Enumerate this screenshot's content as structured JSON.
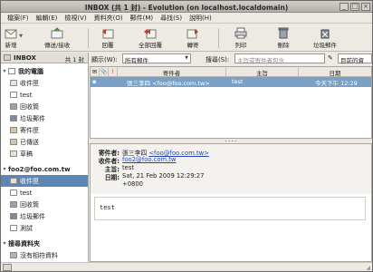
{
  "window": {
    "title": "INBOX (共 1 封) - Evolution (on localhost.localdomain)"
  },
  "menubar": [
    "檔案(F)",
    "編輯(E)",
    "檢視(V)",
    "資料夾(O)",
    "郵件(M)",
    "尋找(S)",
    "說明(H)"
  ],
  "toolbar": {
    "new": "新增",
    "send_receive": "傳送/接收",
    "reply": "回覆",
    "reply_all": "全部回覆",
    "forward": "轉寄",
    "print": "列印",
    "delete": "刪除",
    "junk": "垃圾郵件"
  },
  "sidebar": {
    "title": "INBOX",
    "count": "共 1 封",
    "groups": [
      {
        "name": "我的電腦",
        "items": [
          "收件匣",
          "test",
          "回收筒",
          "垃圾郵件",
          "寄件匣",
          "已傳送",
          "草稿"
        ]
      },
      {
        "name": "foo2@foo.com.tw",
        "items": [
          "收件匣",
          "test",
          "回收筒",
          "垃圾郵件",
          "測試"
        ]
      },
      {
        "name": "搜尋資料夾",
        "items": [
          "沒有相符資料"
        ]
      }
    ]
  },
  "filter": {
    "show_label": "顯示(W):",
    "show_value": "所有郵件",
    "search_label": "搜尋(S):",
    "search_placeholder": "主旨或寄件者包含",
    "scope_value": "目前的資料夾"
  },
  "message_list": {
    "columns": [
      "寄件者",
      "主旨",
      "日期"
    ],
    "rows": [
      {
        "from": "張三李四 <foo@foo.com.tw>",
        "subject": "test",
        "date": "今天下午 12:29"
      }
    ]
  },
  "preview": {
    "labels": {
      "from": "寄件者:",
      "to": "收件者:",
      "subject": "主旨:",
      "date": "日期:"
    },
    "from_name": "張三李四 ",
    "from_email": "<foo@foo.com.tw>",
    "to": "foo2@foo.com.tw",
    "subject": "test",
    "date_line1": "Sat, 21 Feb 2009 12:29:27",
    "date_line2": "+0800",
    "body": "test"
  }
}
